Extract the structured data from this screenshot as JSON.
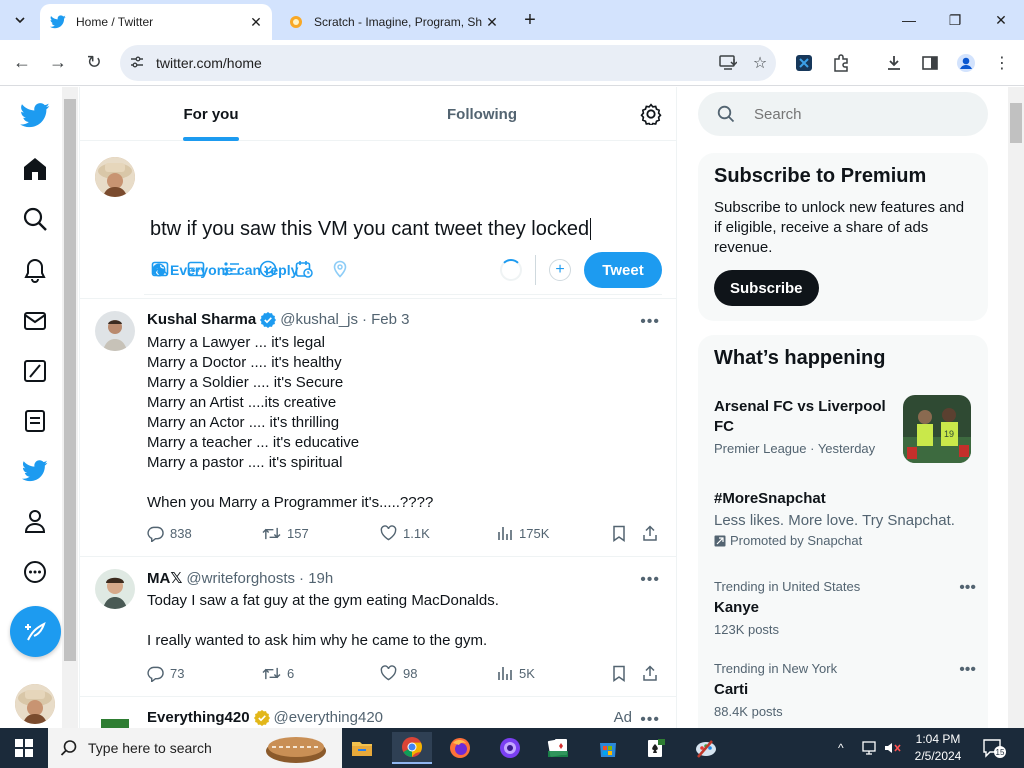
{
  "browser": {
    "tabs": [
      {
        "title": "Home / Twitter",
        "active": true
      },
      {
        "title": "Scratch - Imagine, Program, Sha",
        "active": false
      }
    ],
    "url": "twitter.com/home"
  },
  "feed_tabs": {
    "for_you": "For you",
    "following": "Following"
  },
  "composer": {
    "text": "btw if you saw this VM you cant tweet they locked",
    "reply_setting": "Everyone can reply",
    "tweet_button": "Tweet"
  },
  "tweets": [
    {
      "name": "Kushal Sharma",
      "verified": true,
      "handle": "@kushal_js",
      "time": "· Feb 3",
      "body": "Marry a Lawyer ... it's legal\nMarry a Doctor .... it's healthy\nMarry a Soldier .... it's Secure\nMarry an Artist ....its creative\nMarry an Actor .... it's thrilling\nMarry a teacher ... it's educative\nMarry a pastor .... it's spiritual\n\nWhen you Marry a Programmer it's.....????",
      "replies": "838",
      "retweets": "157",
      "likes": "1.1K",
      "views": "175K"
    },
    {
      "name": "MA𝕏",
      "verified": false,
      "handle": "@writeforghosts",
      "time": "· 19h",
      "body": "Today I saw a fat guy at the gym eating MacDonalds.\n\nI really wanted to ask him why he came to the gym.",
      "replies": "73",
      "retweets": "6",
      "likes": "98",
      "views": "5K"
    },
    {
      "name": "Everything420",
      "handle": "@everything420",
      "ad": "Ad"
    }
  ],
  "sidebar": {
    "search_placeholder": "Search",
    "premium": {
      "title": "Subscribe to Premium",
      "text": "Subscribe to unlock new features and if eligible, receive a share of ads revenue.",
      "button": "Subscribe"
    },
    "happening_title": "What’s happening",
    "trends": [
      {
        "name": "Arsenal FC vs Liverpool FC",
        "meta": "Premier League · Yesterday"
      },
      {
        "name": "#MoreSnapchat",
        "desc": "Less likes. More love. Try Snapchat.",
        "promoted": "Promoted by Snapchat"
      },
      {
        "context": "Trending in United States",
        "name": "Kanye",
        "count": "123K posts"
      },
      {
        "context": "Trending in New York",
        "name": "Carti",
        "count": "88.4K posts"
      }
    ]
  },
  "taskbar": {
    "search_label": "Type here to search",
    "time": "1:04 PM",
    "date": "2/5/2024",
    "notifications": "15"
  },
  "colors": {
    "twitter_blue": "#1d9bf0",
    "text": "#0f1419",
    "muted": "#536471",
    "taskbar": "#1b2a3a"
  }
}
